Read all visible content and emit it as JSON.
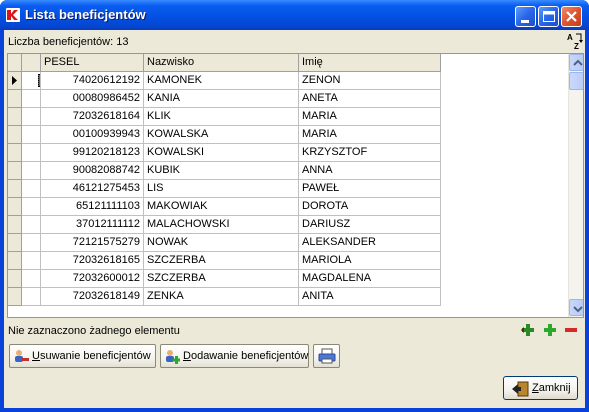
{
  "window": {
    "title": "Lista beneficjentów"
  },
  "header": {
    "count_label": "Liczba beneficjentów: 13"
  },
  "grid": {
    "columns": [
      "PESEL",
      "Nazwisko",
      "Imię"
    ],
    "rows": [
      {
        "pesel": "74020612192",
        "nazwisko": "KAMONEK",
        "imie": "ZENON"
      },
      {
        "pesel": "00080986452",
        "nazwisko": "KANIA",
        "imie": "ANETA"
      },
      {
        "pesel": "72032618164",
        "nazwisko": "KLIK",
        "imie": "MARIA"
      },
      {
        "pesel": "00100939943",
        "nazwisko": "KOWALSKA",
        "imie": "MARIA"
      },
      {
        "pesel": "99120218123",
        "nazwisko": "KOWALSKI",
        "imie": "KRZYSZTOF"
      },
      {
        "pesel": "90082088742",
        "nazwisko": "KUBIK",
        "imie": "ANNA"
      },
      {
        "pesel": "46121275453",
        "nazwisko": "LIS",
        "imie": "PAWEŁ"
      },
      {
        "pesel": "65121111103",
        "nazwisko": "MAKOWIAK",
        "imie": "DOROTA"
      },
      {
        "pesel": "37012111112",
        "nazwisko": "MALACHOWSKI",
        "imie": "DARIUSZ"
      },
      {
        "pesel": "72121575279",
        "nazwisko": "NOWAK",
        "imie": "ALEKSANDER"
      },
      {
        "pesel": "72032618165",
        "nazwisko": "SZCZERBA",
        "imie": "MARIOLA"
      },
      {
        "pesel": "72032600012",
        "nazwisko": "SZCZERBA",
        "imie": "MAGDALENA"
      },
      {
        "pesel": "72032618149",
        "nazwisko": "ZENKA",
        "imie": "ANITA"
      }
    ]
  },
  "status": {
    "text": "Nie zaznaczono żadnego elementu"
  },
  "tabs": [
    {
      "accel": "U",
      "rest": "suwanie beneficjentów"
    },
    {
      "accel": "D",
      "rest": "odawanie beneficjentów"
    }
  ],
  "buttons": {
    "close_accel": "Z",
    "close_rest": "amknij"
  },
  "colors": {
    "accent": "#316ac5",
    "titlebar": "#0452e6"
  }
}
